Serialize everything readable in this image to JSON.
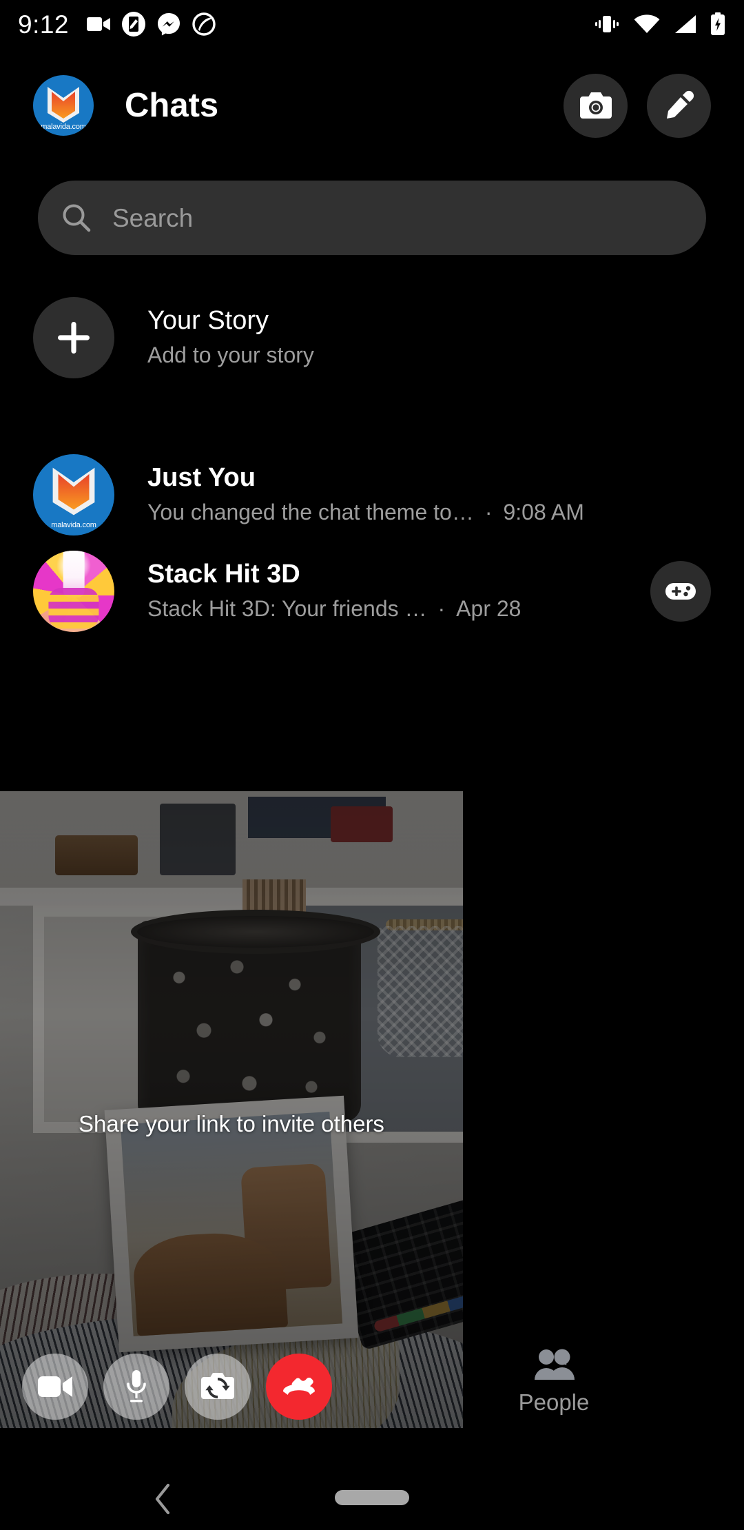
{
  "status_bar": {
    "time": "9:12",
    "left_icons": [
      "video-camera-icon",
      "screenshot-edit-icon",
      "messenger-icon",
      "screen-record-icon"
    ],
    "right_icons": [
      "vibrate-icon",
      "wifi-icon",
      "cellular-signal-icon",
      "battery-charging-icon"
    ]
  },
  "header": {
    "title": "Chats",
    "avatar_label": "malavida.com",
    "camera_button": "camera-icon",
    "compose_button": "compose-pencil-icon"
  },
  "search": {
    "placeholder": "Search",
    "icon": "search-icon"
  },
  "story": {
    "title": "Your Story",
    "subtitle": "Add to your story",
    "add_icon": "plus-icon"
  },
  "chats": [
    {
      "name": "Just You",
      "snippet": "You changed the chat theme to…",
      "separator": "·",
      "time": "9:08 AM",
      "avatar": "malavida-logo-avatar",
      "avatar_label": "malavida.com",
      "badge": null
    },
    {
      "name": "Stack Hit 3D",
      "snippet": "Stack Hit 3D: Your friends …",
      "separator": "·",
      "time": "Apr 28",
      "avatar": "stack-hit-3d-game-avatar",
      "avatar_label": "",
      "badge": "gamepad-icon"
    }
  ],
  "call_overlay": {
    "caption": "Share your link to invite others",
    "controls": [
      {
        "name": "video-toggle-button",
        "icon": "video-camera-icon",
        "style": "light"
      },
      {
        "name": "mute-toggle-button",
        "icon": "microphone-icon",
        "style": "light"
      },
      {
        "name": "flip-camera-button",
        "icon": "flip-camera-icon",
        "style": "light"
      },
      {
        "name": "end-call-button",
        "icon": "end-call-icon",
        "style": "end"
      }
    ]
  },
  "people_tab": {
    "label": "People",
    "icon": "people-icon"
  },
  "nav_bar": {
    "back": "back-chevron-icon",
    "home": "home-pill-indicator"
  },
  "colors": {
    "background": "#000000",
    "surface": "#2c2c2c",
    "search_field": "#313131",
    "primary_text": "#ffffff",
    "secondary_text": "#9d9d9d",
    "brand_blue": "#1878c4",
    "end_call_red": "#f3282f"
  }
}
